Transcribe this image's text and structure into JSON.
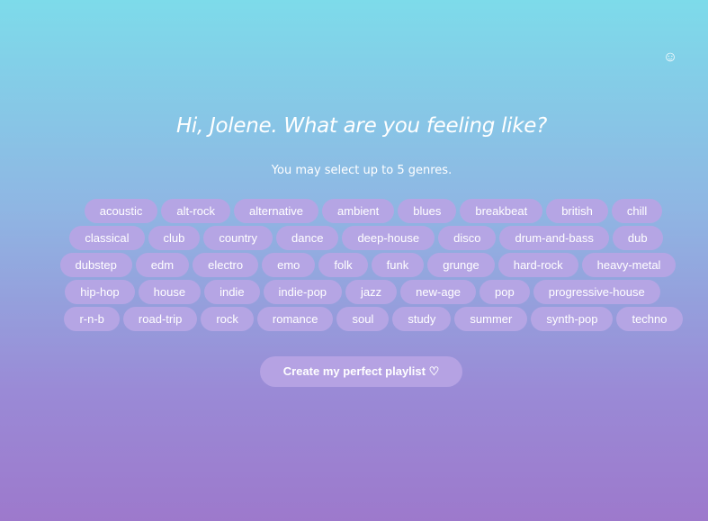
{
  "header": {
    "user_icon": "smiley-icon",
    "user_icon_glyph": "☺"
  },
  "main": {
    "title": "Hi, Jolene. What are you feeling like?",
    "subtitle": "You may select up to 5 genres.",
    "genre_rows": [
      [
        "acoustic",
        "alt-rock",
        "alternative",
        "ambient",
        "blues",
        "breakbeat",
        "british",
        "chill"
      ],
      [
        "classical",
        "club",
        "country",
        "dance",
        "deep-house",
        "disco",
        "drum-and-bass",
        "dub"
      ],
      [
        "dubstep",
        "edm",
        "electro",
        "emo",
        "folk",
        "funk",
        "grunge",
        "hard-rock",
        "heavy-metal"
      ],
      [
        "hip-hop",
        "house",
        "indie",
        "indie-pop",
        "jazz",
        "new-age",
        "pop",
        "progressive-house"
      ],
      [
        "r-n-b",
        "road-trip",
        "rock",
        "romance",
        "soul",
        "study",
        "summer",
        "synth-pop",
        "techno"
      ]
    ],
    "create_button_label": "Create my perfect playlist ♡"
  },
  "colors": {
    "gradient_top": "#7ddbea",
    "gradient_bottom": "#9d79cc",
    "pill_background": "#b5a5e4",
    "text": "#ffffff"
  }
}
